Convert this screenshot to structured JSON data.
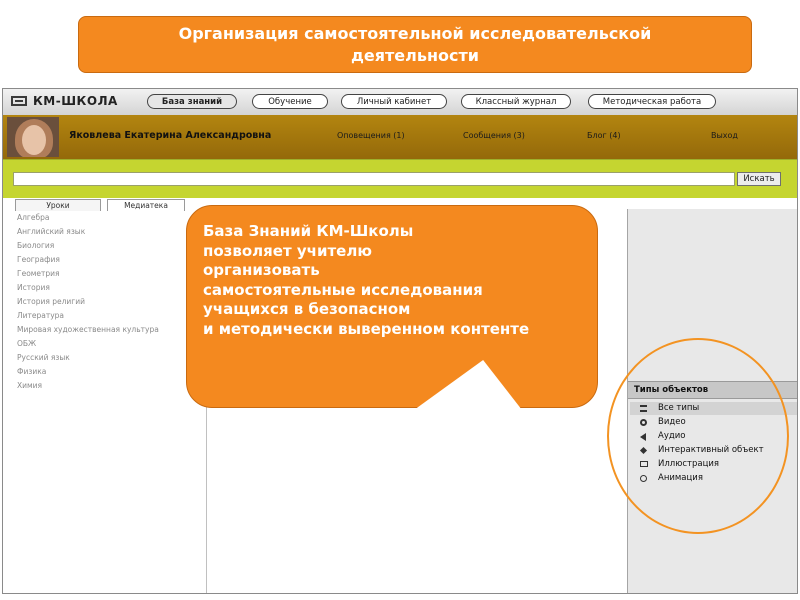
{
  "banner": {
    "title": "Организация самостоятельной исследовательской\nдеятельности"
  },
  "app": {
    "logo": "КМ-ШКОЛА",
    "nav": [
      "База знаний",
      "Обучение",
      "Личный кабинет",
      "Классный журнал",
      "Методическая работа"
    ],
    "user": {
      "name": "Яковлева Екатерина Александровна",
      "notifications": "Оповещения (1)",
      "messages": "Сообщения (3)",
      "blog": "Блог (4)",
      "logout": "Выход"
    },
    "search": {
      "button": "Искать",
      "value": ""
    },
    "left_tabs": [
      "Уроки",
      "Медиатека"
    ],
    "subjects": [
      "Алгебра",
      "Английский язык",
      "Биология",
      "География",
      "Геометрия",
      "История",
      "История религий",
      "Литература",
      "Мировая художественная культура",
      "ОБЖ",
      "Русский язык",
      "Физика",
      "Химия"
    ],
    "types": {
      "title": "Типы объектов",
      "items": [
        "Все типы",
        "Видео",
        "Аудио",
        "Интерактивный объект",
        "Иллюстрация",
        "Анимация"
      ]
    }
  },
  "callout": {
    "text": "База Знаний КМ-Школы\n позволяет  учителю\nорганизовать\nсамостоятельные исследования\nучащихся в безопасном\nи методически выверенном контенте"
  },
  "colors": {
    "accent": "#f4891f",
    "userbar": "#a57a0e",
    "searchbar": "#c5d530"
  }
}
